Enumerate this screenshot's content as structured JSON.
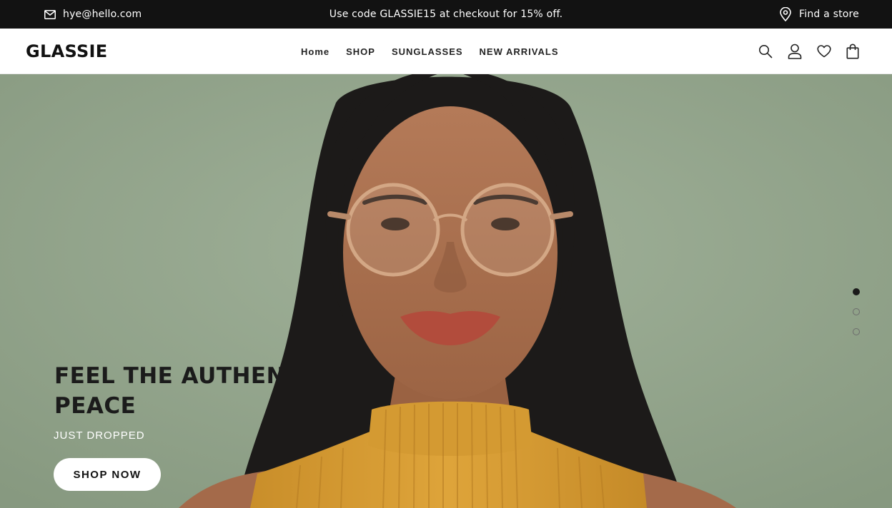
{
  "announcement": {
    "email": "hye@hello.com",
    "promo": "Use code GLASSIE15 at checkout for 15% off.",
    "find_store": "Find a store"
  },
  "header": {
    "logo": "GLASSIE",
    "nav": [
      {
        "label": "Home"
      },
      {
        "label": "SHOP"
      },
      {
        "label": "SUNGLASSES"
      },
      {
        "label": "NEW ARRIVALS"
      }
    ],
    "icons": [
      "search-icon",
      "account-icon",
      "wishlist-icon",
      "cart-icon"
    ]
  },
  "hero": {
    "headline_line1": "FEEL THE AUTHENTIC",
    "headline_line2": "PEACE",
    "subline": "JUST DROPPED",
    "cta_label": "SHOP NOW",
    "slides_total": 3,
    "active_slide": 1,
    "background_color": "#93a58d",
    "sweater_color": "#d9a033"
  },
  "colors": {
    "topbar": "#121212",
    "text_dark": "#1b1b1b",
    "button_bg": "#ffffff"
  }
}
